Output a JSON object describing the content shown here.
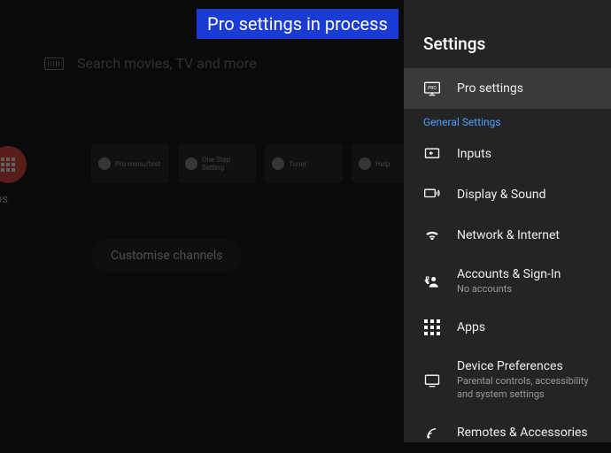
{
  "banner": {
    "text": "Pro settings in process"
  },
  "background": {
    "search_placeholder": "Search movies, TV and more",
    "apps_label": "ps",
    "cards": [
      {
        "label": "Pro menu/test"
      },
      {
        "label": "One Step Setting"
      },
      {
        "label": "Tuner"
      },
      {
        "label": "Help"
      }
    ],
    "customise_label": "Customise channels"
  },
  "settings": {
    "title": "Settings",
    "section_general": "General Settings",
    "items": {
      "pro": {
        "label": "Pro settings"
      },
      "inputs": {
        "label": "Inputs"
      },
      "display": {
        "label": "Display & Sound"
      },
      "network": {
        "label": "Network & Internet"
      },
      "accounts": {
        "label": "Accounts & Sign-In",
        "sub": "No accounts"
      },
      "apps": {
        "label": "Apps"
      },
      "device": {
        "label": "Device Preferences",
        "sub": "Parental controls, accessibility and system settings"
      },
      "remotes": {
        "label": "Remotes & Accessories"
      }
    }
  }
}
